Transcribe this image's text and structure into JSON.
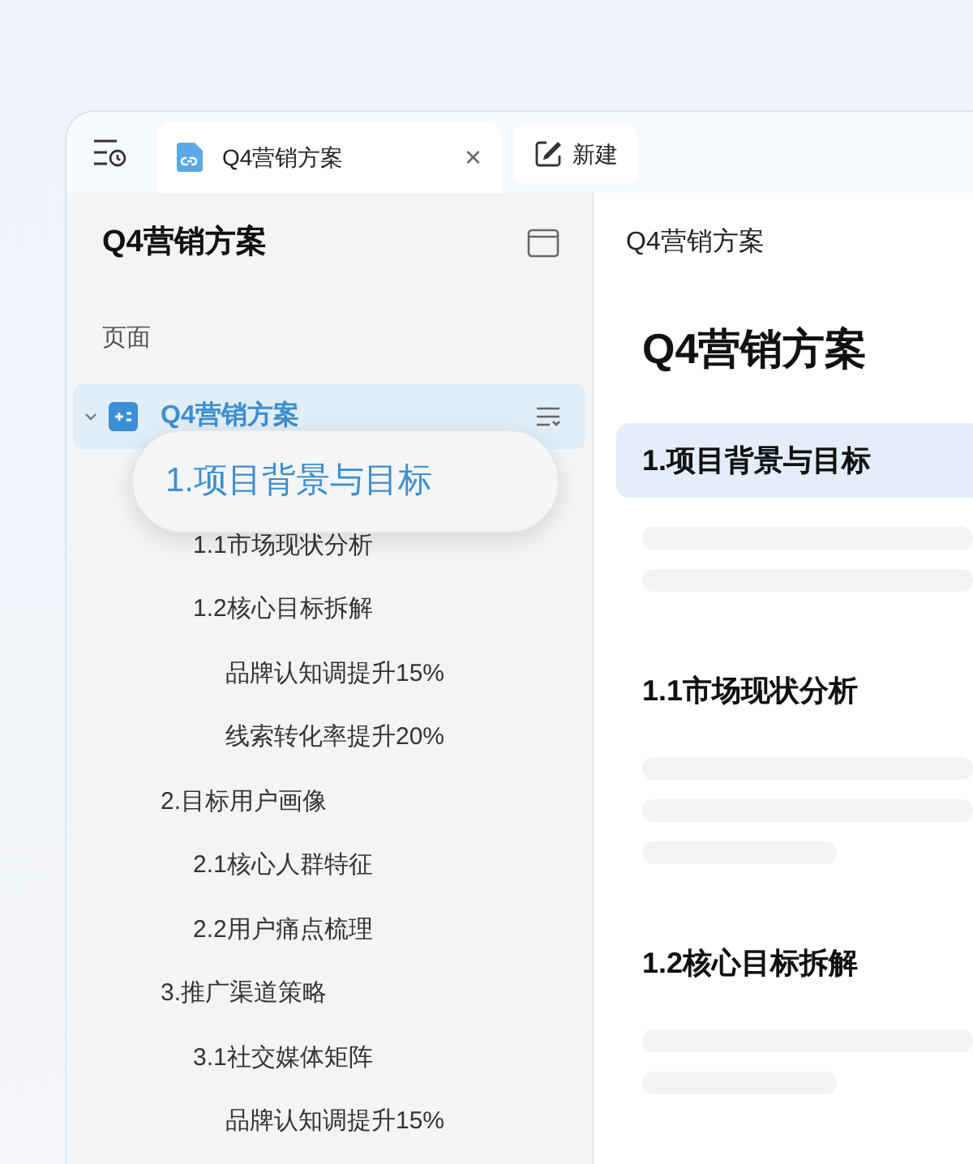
{
  "tabs": [
    {
      "label": "Q4营销方案",
      "close": "×",
      "selected": true
    }
  ],
  "new_button": {
    "label": "新建"
  },
  "sidebar": {
    "title": "Q4营销方案",
    "section_label": "页面",
    "tree": [
      {
        "label": "Q4营销方案",
        "selected": true,
        "expanded": true,
        "dragging": false,
        "children": [
          {
            "label": "1.项目背景与目标",
            "selected": false,
            "dragging": true,
            "children": [
              {
                "label": "1.1市场现状分析",
                "selected": false,
                "dragging": false
              },
              {
                "label": "1.2核心目标拆解",
                "selected": false,
                "dragging": false,
                "children": [
                  {
                    "label": "品牌认知调提升15%",
                    "selected": false,
                    "dragging": false
                  },
                  {
                    "label": "线索转化率提升20%",
                    "selected": false,
                    "dragging": false
                  }
                ]
              }
            ]
          },
          {
            "label": "2.目标用户画像",
            "selected": false,
            "dragging": false,
            "children": [
              {
                "label": "2.1核心人群特征",
                "selected": false,
                "dragging": false
              },
              {
                "label": "2.2用户痛点梳理",
                "selected": false,
                "dragging": false
              }
            ]
          },
          {
            "label": "3.推广渠道策略",
            "selected": false,
            "dragging": false,
            "children": [
              {
                "label": "3.1社交媒体矩阵",
                "selected": false,
                "dragging": false,
                "children": [
                  {
                    "label": "品牌认知调提升15%",
                    "selected": false,
                    "dragging": false
                  }
                ]
              }
            ]
          }
        ]
      }
    ]
  },
  "document": {
    "breadcrumb": "Q4营销方案",
    "title": "Q4营销方案",
    "sections": [
      {
        "heading": "1.项目背景与目标",
        "selected": true
      },
      {
        "heading": "1.1市场现状分析",
        "selected": false
      },
      {
        "heading": "1.2核心目标拆解",
        "selected": false
      }
    ]
  }
}
